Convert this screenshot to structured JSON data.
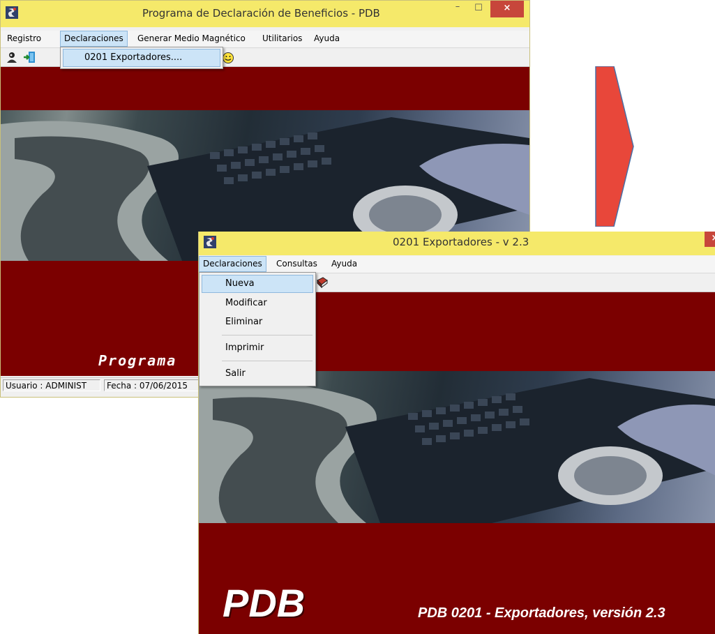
{
  "main_window": {
    "title": "Programa de Declaración de Beneficios - PDB",
    "menu": [
      "Registro",
      "Declaraciones",
      "Generar Medio Magnético",
      "Utilitarios",
      "Ayuda"
    ],
    "active_menu": "Declaraciones",
    "dropdown_items": [
      "0201 Exportadores...."
    ],
    "banner_text": "Programa",
    "status": {
      "user": "Usuario : ADMINIST",
      "date": "Fecha : 07/06/2015"
    }
  },
  "sub_window": {
    "title": "0201 Exportadores - v 2.3",
    "menu": [
      "Declaraciones",
      "Consultas",
      "Ayuda"
    ],
    "active_menu": "Declaraciones",
    "dropdown_items": [
      "Nueva",
      "Modificar",
      "Eliminar",
      "Imprimir",
      "Salir"
    ],
    "highlighted_item": "Nueva",
    "logo_text": "PDB",
    "version_text": "PDB 0201 - Exportadores, versión 2.3"
  },
  "window_controls": {
    "minimize": "–",
    "maximize": "☐",
    "close": "×"
  },
  "arrow": {
    "direction": "right",
    "color": "#e8473a",
    "stroke": "#4a6fa5"
  },
  "colors": {
    "titlebar": "#f5e96a",
    "maroon": "#7b0000",
    "menu_highlight": "#cce4f7"
  }
}
